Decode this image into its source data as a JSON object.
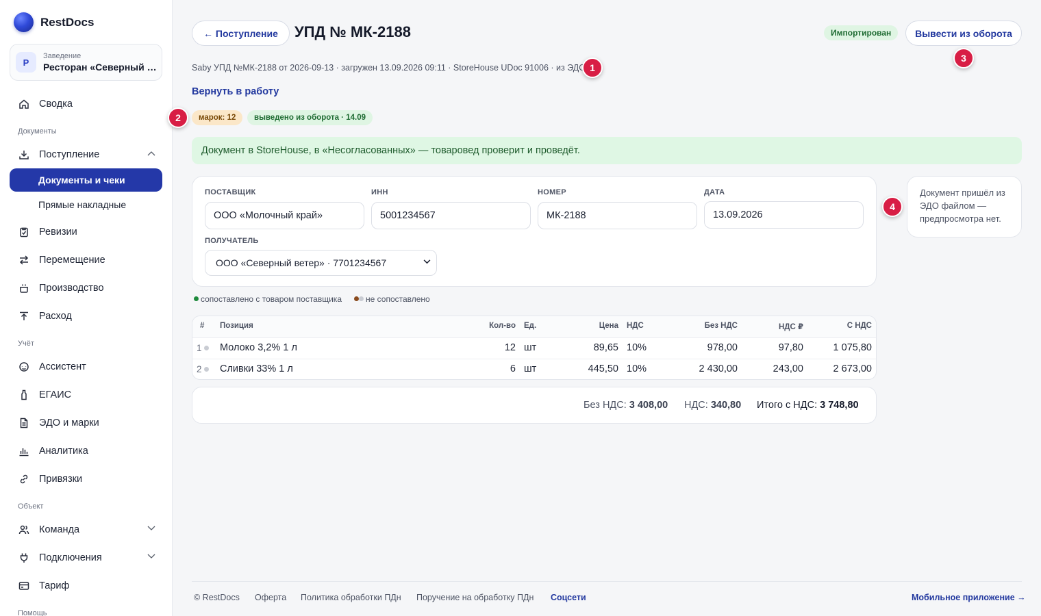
{
  "app": {
    "name": "RestDocs"
  },
  "venue": {
    "caption": "Заведение",
    "badge": "Р",
    "name": "Ресторан «Северный ветер»"
  },
  "nav": {
    "dashboard": "Сводка",
    "section_documents": "Документы",
    "receipts": "Поступление",
    "docs_and_checks": "Документы и чеки",
    "direct_invoices": "Прямые накладные",
    "revisions": "Ревизии",
    "transfer": "Перемещение",
    "production": "Производство",
    "expense": "Расход",
    "section_accounting": "Учёт",
    "assistant": "Ассистент",
    "egais": "ЕГАИС",
    "edo": "ЭДО и марки",
    "analytics": "Аналитика",
    "bindings": "Привязки",
    "section_object": "Объект",
    "team": "Команда",
    "connections": "Подключения",
    "tariff": "Тариф",
    "section_help": "Помощь"
  },
  "header": {
    "back_label": "← Поступление",
    "title": "УПД № МК-2188",
    "status": "Импортирован",
    "withdraw_label": "Вывести из оборота"
  },
  "meta_line": "Saby УПД №МК-2188 от 2026-09-13 · загружен 13.09.2026 09:11 · StoreHouse UDoc 91006 · из ЭДО",
  "return_link": "Вернуть в работу",
  "pills": {
    "marks": "марок: 12",
    "withdrawn": "выведено из оборота · 14.09"
  },
  "banner": "Документ в StoreHouse, в «Несогласованных» — товаровед проверит и проведёт.",
  "form": {
    "supplier_label": "ПОСТАВЩИК",
    "supplier": "ООО «Молочный край»",
    "inn_label": "ИНН",
    "inn": "5001234567",
    "number_label": "НОМЕР",
    "number": "МК-2188",
    "date_label": "ДАТА",
    "date": "13.09.2026",
    "recipient_label": "ПОЛУЧАТЕЛЬ",
    "recipient": "ООО «Северный ветер» · 7701234567"
  },
  "side_note": "Документ пришёл из ЭДО файлом — предпросмотра нет.",
  "legend": {
    "matched": "сопоставлено с товаром поставщика",
    "unmatched": "не сопоставлено",
    "matched_color": "#1e8a3c",
    "unmatched_color": "#8a4b1e"
  },
  "table": {
    "headers": {
      "num": "#",
      "item": "Позиция",
      "qty": "Кол-во",
      "unit": "Ед.",
      "price": "Цена",
      "vat": "НДС",
      "net": "Без НДС",
      "vat_rub": "НДС ₽",
      "gross": "С НДС"
    },
    "rows": [
      {
        "num": "1",
        "item": "Молоко 3,2% 1 л",
        "qty": "12",
        "unit": "шт",
        "price": "89,65",
        "vat": "10%",
        "net": "978,00",
        "vat_rub": "97,80",
        "gross": "1 075,80"
      },
      {
        "num": "2",
        "item": "Сливки 33% 1 л",
        "qty": "6",
        "unit": "шт",
        "price": "445,50",
        "vat": "10%",
        "net": "2 430,00",
        "vat_rub": "243,00",
        "gross": "2 673,00"
      }
    ]
  },
  "totals": {
    "net_label": "Без НДС:",
    "net": "3 408,00",
    "vat_label": "НДС:",
    "vat": "340,80",
    "gross_label": "Итого с НДС:",
    "gross": "3 748,80"
  },
  "markers": [
    "1",
    "2",
    "3",
    "4"
  ],
  "footer": {
    "copyright": "© RestDocs",
    "offer": "Оферта",
    "policy": "Политика обработки ПДн",
    "instruction": "Поручение на обработку ПДн",
    "social": "Соцсети",
    "mobile": "Мобильное приложение →"
  },
  "colors": {
    "accent": "#23399f",
    "active_nav": "#2438a8",
    "marker": "#d81e45",
    "success_bg": "#dff7e4"
  }
}
